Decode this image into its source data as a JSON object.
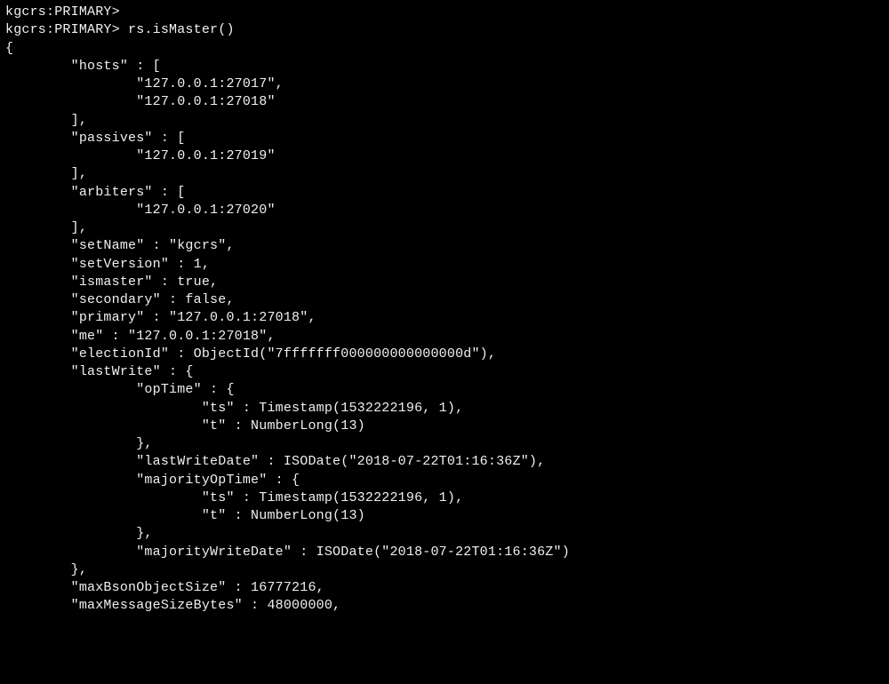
{
  "prompt": "kgcrs:PRIMARY>",
  "command": "rs.isMaster()",
  "lines": [
    "kgcrs:PRIMARY>",
    "kgcrs:PRIMARY> rs.isMaster()",
    "{",
    "        \"hosts\" : [",
    "                \"127.0.0.1:27017\",",
    "                \"127.0.0.1:27018\"",
    "        ],",
    "        \"passives\" : [",
    "                \"127.0.0.1:27019\"",
    "        ],",
    "        \"arbiters\" : [",
    "                \"127.0.0.1:27020\"",
    "        ],",
    "        \"setName\" : \"kgcrs\",",
    "        \"setVersion\" : 1,",
    "        \"ismaster\" : true,",
    "        \"secondary\" : false,",
    "        \"primary\" : \"127.0.0.1:27018\",",
    "        \"me\" : \"127.0.0.1:27018\",",
    "        \"electionId\" : ObjectId(\"7fffffff000000000000000d\"),",
    "        \"lastWrite\" : {",
    "                \"opTime\" : {",
    "                        \"ts\" : Timestamp(1532222196, 1),",
    "                        \"t\" : NumberLong(13)",
    "                },",
    "                \"lastWriteDate\" : ISODate(\"2018-07-22T01:16:36Z\"),",
    "                \"majorityOpTime\" : {",
    "                        \"ts\" : Timestamp(1532222196, 1),",
    "                        \"t\" : NumberLong(13)",
    "                },",
    "                \"majorityWriteDate\" : ISODate(\"2018-07-22T01:16:36Z\")",
    "        },",
    "        \"maxBsonObjectSize\" : 16777216,",
    "        \"maxMessageSizeBytes\" : 48000000,"
  ],
  "response": {
    "hosts": [
      "127.0.0.1:27017",
      "127.0.0.1:27018"
    ],
    "passives": [
      "127.0.0.1:27019"
    ],
    "arbiters": [
      "127.0.0.1:27020"
    ],
    "setName": "kgcrs",
    "setVersion": 1,
    "ismaster": true,
    "secondary": false,
    "primary": "127.0.0.1:27018",
    "me": "127.0.0.1:27018",
    "electionId": "ObjectId(\"7fffffff000000000000000d\")",
    "lastWrite": {
      "opTime": {
        "ts": "Timestamp(1532222196, 1)",
        "t": "NumberLong(13)"
      },
      "lastWriteDate": "ISODate(\"2018-07-22T01:16:36Z\")",
      "majorityOpTime": {
        "ts": "Timestamp(1532222196, 1)",
        "t": "NumberLong(13)"
      },
      "majorityWriteDate": "ISODate(\"2018-07-22T01:16:36Z\")"
    },
    "maxBsonObjectSize": 16777216,
    "maxMessageSizeBytes": 48000000
  }
}
